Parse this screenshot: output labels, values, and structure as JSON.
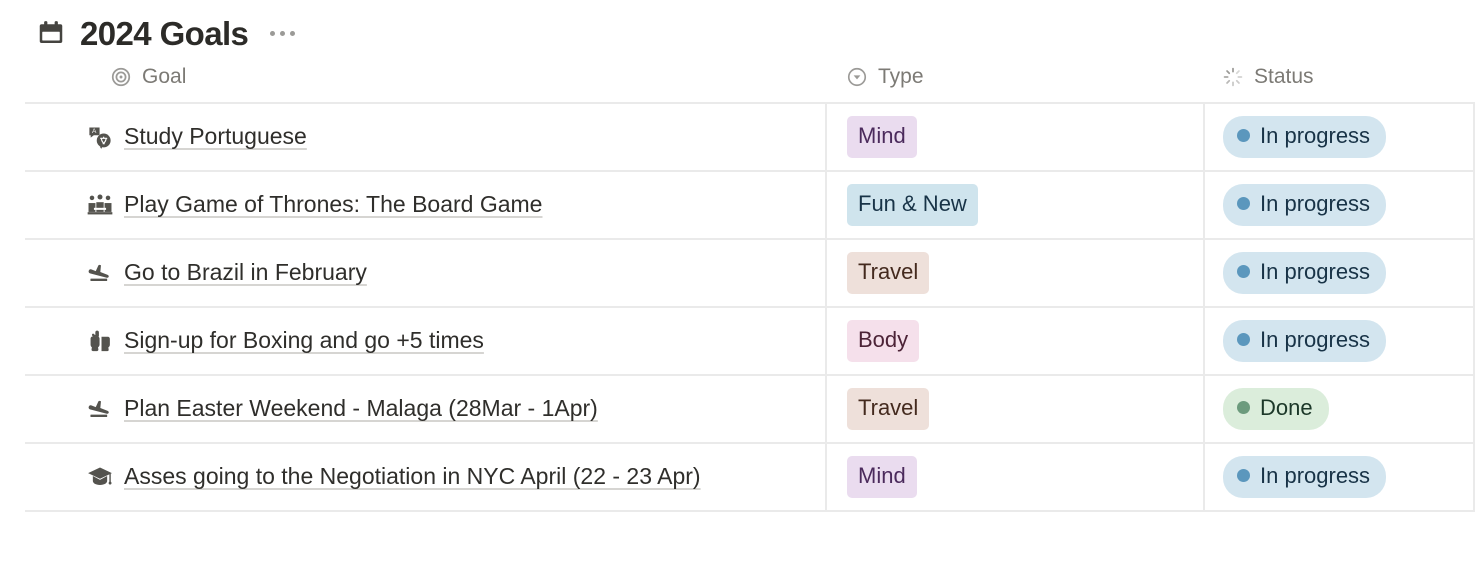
{
  "header": {
    "icon": "calendar-icon",
    "title": "2024 Goals",
    "more_label": "…"
  },
  "table": {
    "columns": [
      {
        "key": "goal",
        "label": "Goal",
        "icon": "target-icon"
      },
      {
        "key": "type",
        "label": "Type",
        "icon": "select-circle-chevron-icon"
      },
      {
        "key": "status",
        "label": "Status",
        "icon": "status-spinner-icon"
      }
    ],
    "rows": [
      {
        "icon": "translate-icon",
        "title": "Study Portuguese",
        "type": {
          "label": "Mind",
          "bg": "#eadcef",
          "fg": "#4b2a5c"
        },
        "status": {
          "label": "In progress",
          "bg": "#d3e5ef",
          "fg": "#183347",
          "dot": "#5b97bd"
        }
      },
      {
        "icon": "people-meeting-icon",
        "title": "Play Game of Thrones: The Board Game",
        "type": {
          "label": "Fun & New",
          "bg": "#cfe4ed",
          "fg": "#183347"
        },
        "status": {
          "label": "In progress",
          "bg": "#d3e5ef",
          "fg": "#183347",
          "dot": "#5b97bd"
        }
      },
      {
        "icon": "airplane-landing-icon",
        "title": "Go to Brazil in February",
        "type": {
          "label": "Travel",
          "bg": "#eee0da",
          "fg": "#442a1e"
        },
        "status": {
          "label": "In progress",
          "bg": "#d3e5ef",
          "fg": "#183347",
          "dot": "#5b97bd"
        }
      },
      {
        "icon": "boxing-glove-icon",
        "title": "Sign-up for Boxing and go +5 times",
        "type": {
          "label": "Body",
          "bg": "#f5e0eb",
          "fg": "#4c2337"
        },
        "status": {
          "label": "In progress",
          "bg": "#d3e5ef",
          "fg": "#183347",
          "dot": "#5b97bd"
        }
      },
      {
        "icon": "airplane-landing-icon",
        "title": "Plan Easter Weekend - Malaga (28Mar - 1Apr)",
        "type": {
          "label": "Travel",
          "bg": "#eee0da",
          "fg": "#442a1e"
        },
        "status": {
          "label": "Done",
          "bg": "#dbeddb",
          "fg": "#1c3829",
          "dot": "#6c9b7d"
        }
      },
      {
        "icon": "graduation-cap-icon",
        "title": "Asses going to the Negotiation in NYC April (22 - 23 Apr)",
        "type": {
          "label": "Mind",
          "bg": "#eadcef",
          "fg": "#4b2a5c"
        },
        "status": {
          "label": "In progress",
          "bg": "#d3e5ef",
          "fg": "#183347",
          "dot": "#5b97bd"
        }
      }
    ]
  }
}
